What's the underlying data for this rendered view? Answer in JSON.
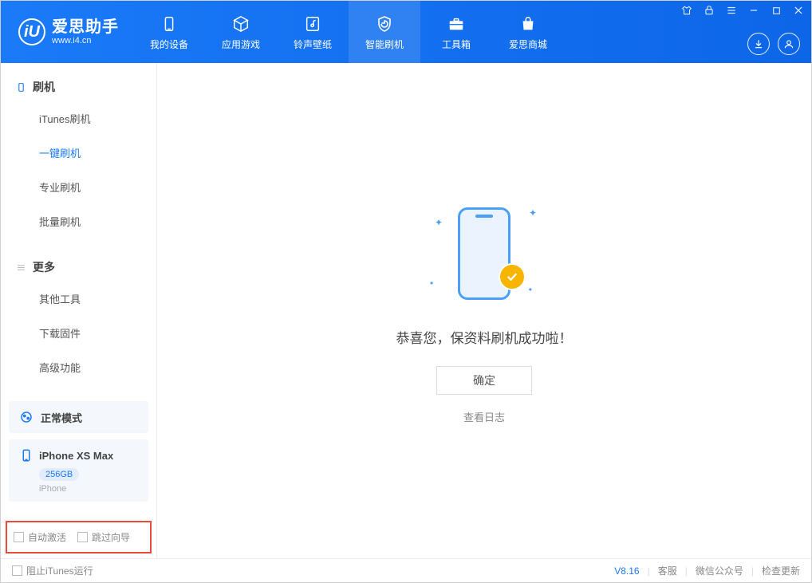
{
  "logo": {
    "title": "爱思助手",
    "sub": "www.i4.cn",
    "mark": "iU"
  },
  "nav": [
    {
      "label": "我的设备",
      "icon": "device"
    },
    {
      "label": "应用游戏",
      "icon": "cube"
    },
    {
      "label": "铃声壁纸",
      "icon": "music"
    },
    {
      "label": "智能刷机",
      "icon": "shield",
      "active": true
    },
    {
      "label": "工具箱",
      "icon": "toolbox"
    },
    {
      "label": "爱思商城",
      "icon": "bag"
    }
  ],
  "sidebar": {
    "section1": {
      "title": "刷机"
    },
    "items1": [
      {
        "label": "iTunes刷机"
      },
      {
        "label": "一键刷机",
        "active": true
      },
      {
        "label": "专业刷机"
      },
      {
        "label": "批量刷机"
      }
    ],
    "section2": {
      "title": "更多"
    },
    "items2": [
      {
        "label": "其他工具"
      },
      {
        "label": "下载固件"
      },
      {
        "label": "高级功能"
      }
    ]
  },
  "mode_card": {
    "label": "正常模式"
  },
  "device_card": {
    "name": "iPhone XS Max",
    "capacity": "256GB",
    "type": "iPhone"
  },
  "options": {
    "auto_activate": "自动激活",
    "skip_guide": "跳过向导"
  },
  "main": {
    "message": "恭喜您，保资料刷机成功啦！",
    "ok": "确定",
    "view_log": "查看日志"
  },
  "statusbar": {
    "block_itunes": "阻止iTunes运行",
    "version": "V8.16",
    "support": "客服",
    "wechat": "微信公众号",
    "check_update": "检查更新"
  }
}
